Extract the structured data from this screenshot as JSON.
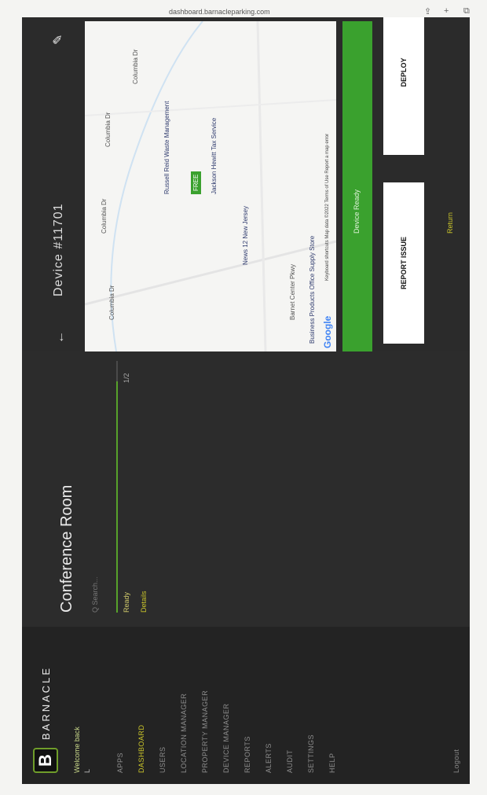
{
  "browser": {
    "url": "dashboard.barnacleparking.com"
  },
  "sidebar": {
    "brand": "BARNACLE",
    "logo_letter": "B",
    "user_line": "Welcome back",
    "user_sub": "L",
    "items": [
      {
        "label": "Apps",
        "active": false
      },
      {
        "label": "Dashboard",
        "active": true
      },
      {
        "label": "Users",
        "active": false
      },
      {
        "label": "Location Manager",
        "active": false
      },
      {
        "label": "Property Manager",
        "active": false
      },
      {
        "label": "Device Manager",
        "active": false
      },
      {
        "label": "Reports",
        "active": false
      },
      {
        "label": "Alerts",
        "active": false
      },
      {
        "label": "Audit",
        "active": false
      },
      {
        "label": "Settings",
        "active": false
      },
      {
        "label": "Help",
        "active": false
      }
    ],
    "logout": "Logout"
  },
  "room": {
    "title": "Conference Room",
    "search": "Q Search...",
    "status_left": "Ready",
    "status_right": "1/2",
    "status_fraction": 0.92,
    "link": "Details"
  },
  "device": {
    "title": "Device #11701",
    "map": {
      "streets": [
        "Columbia Dr",
        "Columbia Dr",
        "Columbia Dr",
        "Columbia Dr",
        "Barnet Center Pkwy"
      ],
      "pins": [
        "Russell Reid Waste Management",
        "News 12 New Jersey",
        "Jackson Hewitt Tax Service",
        "Business Products Office Supply Store"
      ],
      "badge": "FREE",
      "attribution": "Keyboard shortcuts  Map data ©2022  Terms of Use  Report a map error",
      "google": "Google"
    },
    "status_bar": "Device Ready",
    "report_button": "REPORT ISSUE",
    "deploy_button": "DEPLOY",
    "footer_link": "Return"
  }
}
